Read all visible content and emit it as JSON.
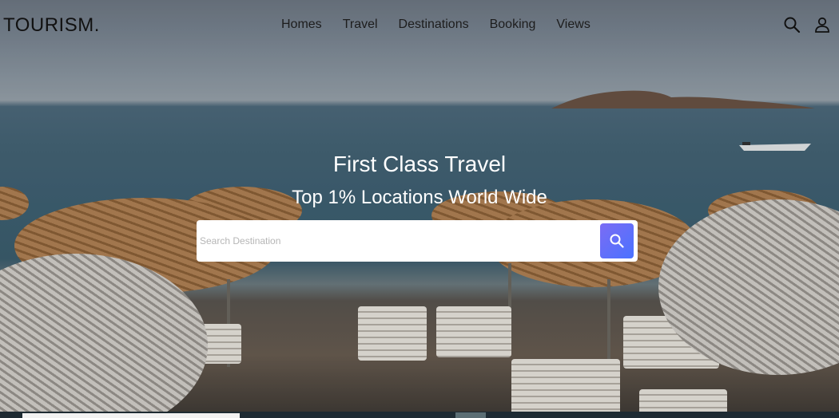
{
  "brand": {
    "logo": "TOURISM."
  },
  "nav": {
    "items": [
      "Homes",
      "Travel",
      "Destinations",
      "Booking",
      "Views"
    ],
    "icons": [
      "search-icon",
      "user-icon"
    ]
  },
  "hero": {
    "title": "First Class Travel",
    "subtitle": "Top 1% Locations World Wide",
    "search": {
      "placeholder": "Search Destination",
      "button_icon": "search-icon"
    }
  },
  "colors": {
    "accent_start": "#7b6cf4",
    "accent_end": "#4a72ff",
    "text_dark": "#111111"
  }
}
